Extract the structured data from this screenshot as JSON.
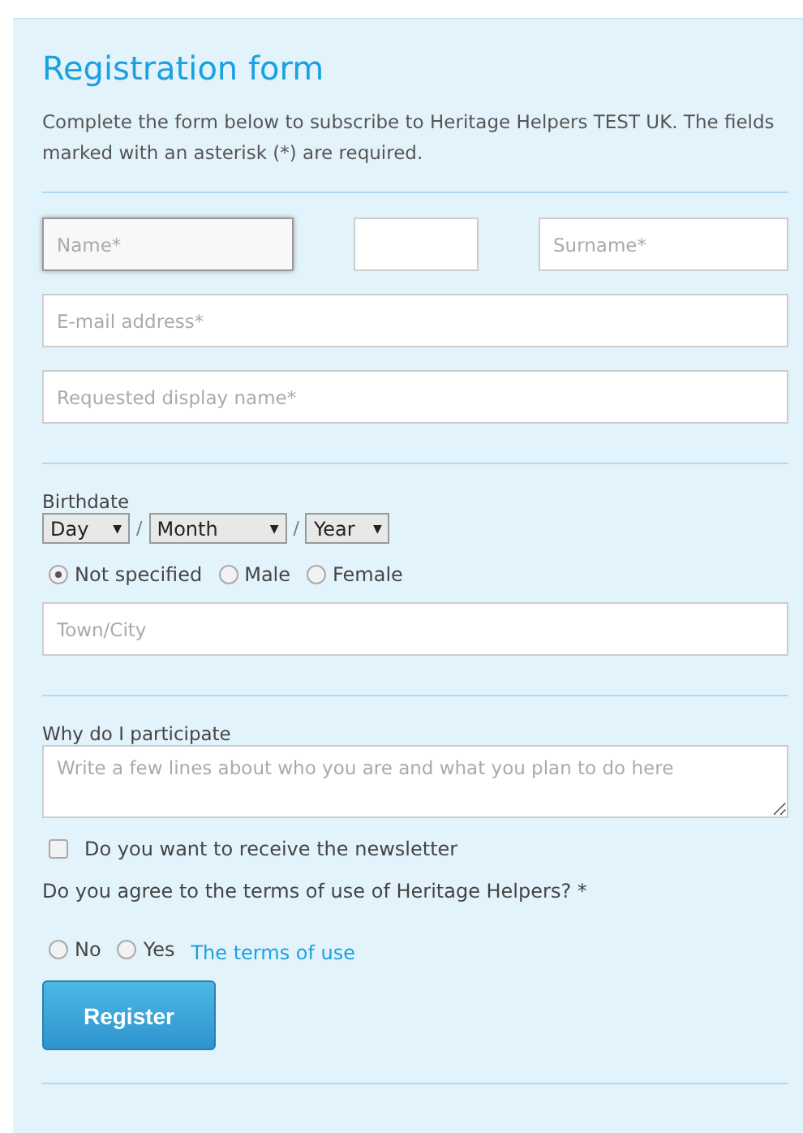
{
  "title": "Registration form",
  "intro": "Complete the form below to subscribe to Heritage Helpers TEST UK. The fields marked with an asterisk (*) are required.",
  "name_row": [
    {
      "placeholder": "Name*",
      "focused": true
    },
    {
      "focused": false
    },
    {
      "placeholder": "Surname*",
      "focused": false
    }
  ],
  "email": {
    "placeholder": "E-mail address*"
  },
  "display_name": {
    "placeholder": "Requested display name*"
  },
  "birthdate": {
    "label": "Birthdate",
    "separator": "/",
    "selects": [
      {
        "value": "Day",
        "arrow": "▼"
      },
      {
        "value": "Month",
        "arrow": "▼"
      },
      {
        "value": "Year",
        "arrow": "▼"
      }
    ]
  },
  "gender": [
    {
      "label": "Not specified",
      "selected": true
    },
    {
      "label": "Male",
      "selected": false
    },
    {
      "label": "Female",
      "selected": false
    }
  ],
  "town": {
    "placeholder": "Town/City"
  },
  "participate": {
    "label": "Why do I participate",
    "placeholder": "Write a few lines about who you are and what you plan to do here"
  },
  "newsletter": {
    "label": "Do you want to receive the newsletter",
    "checked": false
  },
  "terms": {
    "question": "Do you agree to the terms of use of Heritage Helpers? *",
    "options": [
      {
        "label": "No",
        "selected": false
      },
      {
        "label": "Yes",
        "selected": false
      }
    ],
    "link": "The terms of use"
  },
  "submit": "Register"
}
